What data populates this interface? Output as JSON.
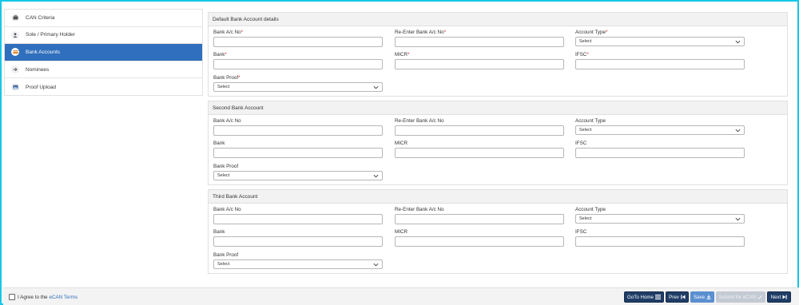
{
  "sidebar": {
    "items": [
      {
        "label": "CAN Criteria",
        "icon": "briefcase-icon"
      },
      {
        "label": "Sole / Primary Holder",
        "icon": "user-icon"
      },
      {
        "label": "Bank Accounts",
        "icon": "bank-card-icon",
        "active": true
      },
      {
        "label": "Nominees",
        "icon": "arrow-right-icon"
      },
      {
        "label": "Proof Upload",
        "icon": "image-icon"
      }
    ]
  },
  "sections": [
    {
      "title": "Default Bank Account details",
      "bank_ac_label": "Bank A/c No",
      "reenter_label": "Re-Enter Bank A/c No",
      "account_type_label": "Account Type",
      "account_type_value": "Select",
      "bank_label": "Bank",
      "micr_label": "MICR",
      "ifsc_label": "IFSC",
      "bank_proof_label": "Bank Proof",
      "bank_proof_value": "Select",
      "required_mark": "*"
    },
    {
      "title": "Second Bank Account",
      "bank_ac_label": "Bank A/c No",
      "reenter_label": "Re-Enter Bank A/c No",
      "account_type_label": "Account Type",
      "account_type_value": "Select",
      "bank_label": "Bank",
      "micr_label": "MICR",
      "ifsc_label": "IFSC",
      "bank_proof_label": "Bank Proof",
      "bank_proof_value": "Select"
    },
    {
      "title": "Third Bank Account",
      "bank_ac_label": "Bank A/c No",
      "reenter_label": "Re-Enter Bank A/c No",
      "account_type_label": "Account Type",
      "account_type_value": "Select",
      "bank_label": "Bank",
      "micr_label": "MICR",
      "ifsc_label": "IFSC",
      "bank_proof_label": "Bank Proof",
      "bank_proof_value": "Select"
    }
  ],
  "footer": {
    "agree_text": "I Agree to the",
    "terms_link": "eCAN Terms",
    "goto_home": "GoTo Home",
    "prev": "Prev",
    "save": "Save",
    "submit": "Submit for eCAN",
    "next": "Next"
  },
  "colors": {
    "accent": "#2f6fbd",
    "frame": "#13c8e8",
    "dark_button": "#1f3d66",
    "required": "#d9232e"
  }
}
